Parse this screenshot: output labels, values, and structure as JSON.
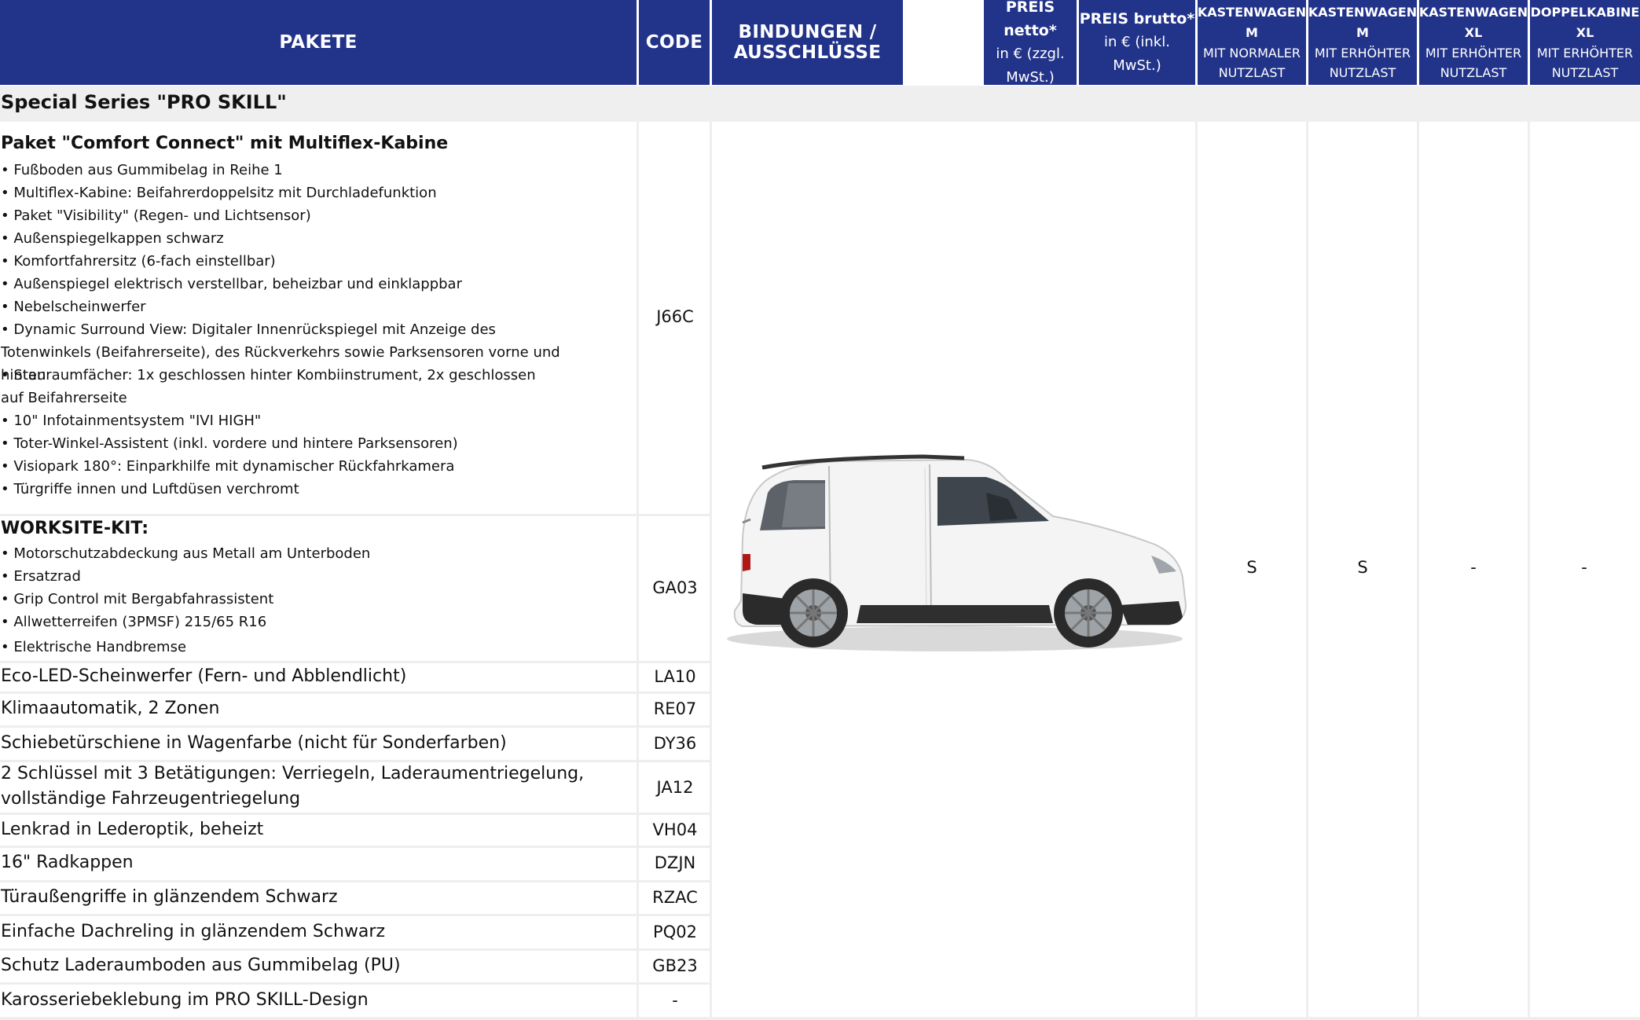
{
  "header": {
    "pakete": "PAKETE",
    "code": "CODE",
    "bindungen": "BINDUNGEN / AUSSCHLÜSSE",
    "preis_netto": {
      "title": "PREIS netto*",
      "line1": "in € (zzgl.",
      "line2": "MwSt.)"
    },
    "preis_brutto": {
      "title": "PREIS brutto*",
      "line1": "in € (inkl.",
      "line2": "MwSt.)"
    },
    "variants": [
      {
        "line1": "KASTENWAGEN",
        "line2": "M",
        "line3": "MIT NORMALER",
        "line4": "NUTZLAST"
      },
      {
        "line1": "KASTENWAGEN",
        "line2": "M",
        "line3": "MIT ERHÖHTER",
        "line4": "NUTZLAST"
      },
      {
        "line1": "KASTENWAGEN",
        "line2": "XL",
        "line3": "MIT ERHÖHTER",
        "line4": "NUTZLAST"
      },
      {
        "line1": "DOPPELKABINE",
        "line2": "XL",
        "line3": "MIT ERHÖHTER",
        "line4": "NUTZLAST"
      }
    ]
  },
  "section_title": "Special Series \"PRO SKILL\"",
  "package_comfort": {
    "title": "Paket \"Comfort Connect\" mit Multiflex-Kabine",
    "code": "J66C",
    "items": [
      "•  Fußboden aus Gummibelag in Reihe 1",
      "•  Multiflex-Kabine: Beifahrerdoppelsitz mit Durchladefunktion ",
      "•  Paket \"Visibility\" (Regen- und Lichtsensor)",
      "•  Außenspiegelkappen schwarz ",
      "•  Komfortfahrersitz (6-fach einstellbar)",
      "•  Außenspiegel elektrisch verstellbar, beheizbar und einklappbar",
      "•  Nebelscheinwerfer",
      "•  Dynamic Surround View: Digitaler Innenrückspiegel mit Anzeige des Totenwinkels (Beifahrerseite), des Rückverkehrs sowie Parksensoren vorne und hinten",
      "•  Stauraumfächer: 1x geschlossen hinter Kombiinstrument, 2x geschlossen auf Beifahrerseite",
      "•  10\" Infotainmentsystem \"IVI HIGH\" ",
      "•  Toter-Winkel-Assistent (inkl. vordere und hintere Parksensoren)",
      "•  Visiopark 180°: Einparkhilfe mit dynamischer Rückfahrkamera",
      "•  Türgriffe innen und Luftdüsen verchromt"
    ]
  },
  "package_worksite": {
    "title": "WORKSITE-KIT:",
    "code": "GA03",
    "items": [
      "•  Motorschutzabdeckung aus Metall am Unterboden",
      "•  Ersatzrad",
      "•  Grip Control mit Bergabfahrassistent",
      "•  Allwetterreifen (3PMSF) 215/65 R16",
      "•  Elektrische Handbremse"
    ]
  },
  "rows": [
    {
      "label": "Eco-LED-Scheinwerfer (Fern- und Abblendlicht)",
      "code": "LA10"
    },
    {
      "label": "Klimaautomatik, 2 Zonen",
      "code": "RE07"
    },
    {
      "label": "Schiebetürschiene in Wagenfarbe (nicht für Sonderfarben)",
      "code": "DY36"
    },
    {
      "label": "2 Schlüssel mit 3 Betätigungen: Verriegeln, Laderaumentriegelung, vollständige Fahrzeugentriegelung",
      "code": "JA12"
    },
    {
      "label": "Lenkrad in Lederoptik, beheizt",
      "code": "VH04"
    },
    {
      "label": "16\" Radkappen",
      "code": "DZJN"
    },
    {
      "label": "Türaußengriffe in glänzendem Schwarz",
      "code": "RZAC"
    },
    {
      "label": "Einfache Dachreling in glänzendem Schwarz",
      "code": "PQ02"
    },
    {
      "label": "Schutz Laderaumboden aus Gummibelag (PU)",
      "code": "GB23"
    },
    {
      "label": "Karosseriebeklebung im PRO SKILL-Design",
      "code": "-"
    }
  ],
  "availability": [
    "S",
    "S",
    "-",
    "-"
  ],
  "colors": {
    "header_bg": "#22338a",
    "section_bg": "#efefef",
    "grid": "#eeeeee"
  }
}
